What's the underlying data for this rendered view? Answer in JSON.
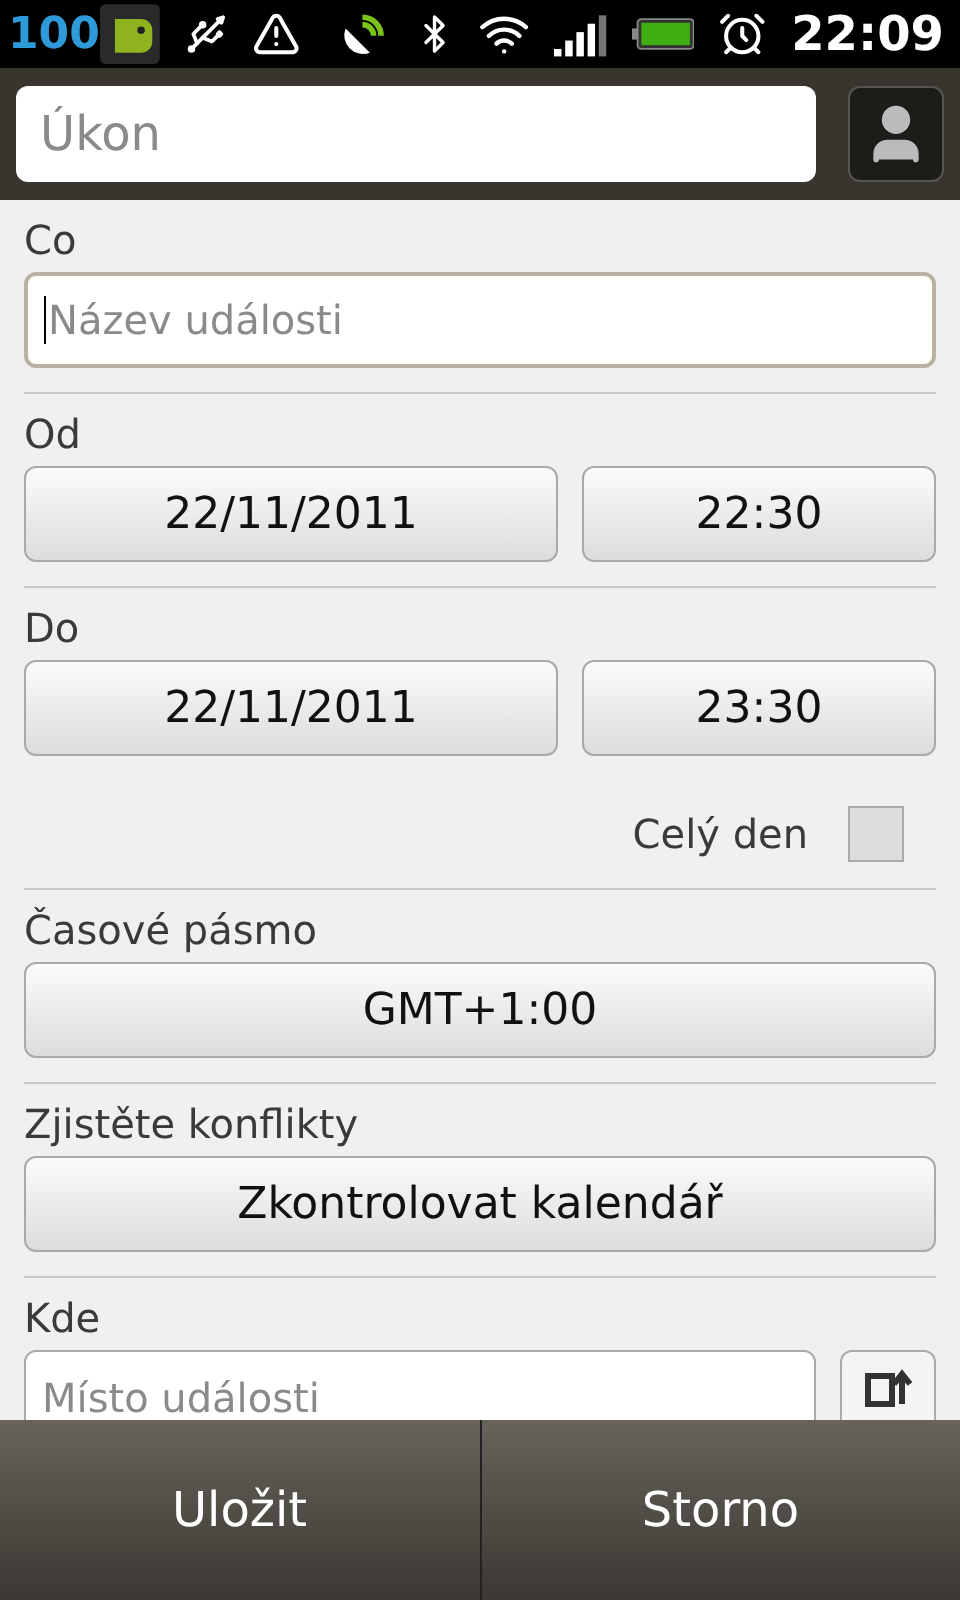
{
  "status_bar": {
    "battery_percent": "100",
    "time": "22:09"
  },
  "top_bar": {
    "search": {
      "placeholder": "Úkon"
    }
  },
  "form": {
    "what": {
      "label": "Co",
      "placeholder": "Název události",
      "focused": true
    },
    "from": {
      "label": "Od",
      "date": "22/11/2011",
      "time": "22:30"
    },
    "to": {
      "label": "Do",
      "date": "22/11/2011",
      "time": "23:30"
    },
    "all_day": {
      "label": "Celý den",
      "checked": false
    },
    "timezone": {
      "label": "Časové pásmo",
      "value": "GMT+1:00"
    },
    "conflicts": {
      "label": "Zjistěte konflikty",
      "button": "Zkontrolovat kalendář"
    },
    "where": {
      "label": "Kde",
      "placeholder": "Místo události"
    }
  },
  "bottom_bar": {
    "buttons": [
      "Uložit",
      "Storno"
    ]
  }
}
